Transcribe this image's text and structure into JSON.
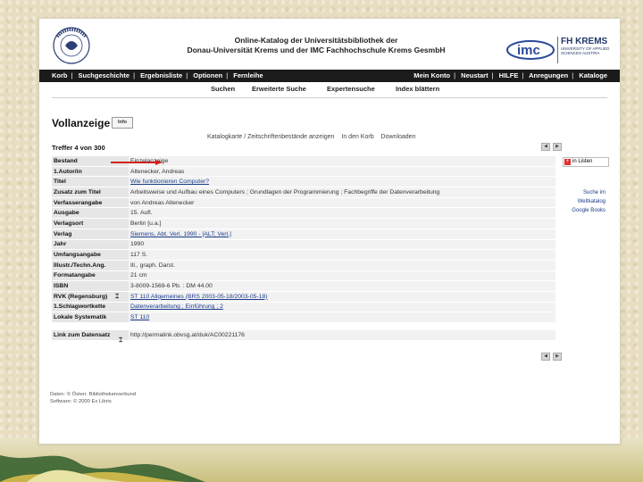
{
  "header": {
    "title_line1": "Online-Katalog der Universitätsbibliothek der",
    "title_line2": "Donau-Universität Krems und der IMC Fachhochschule Krems GesmbH",
    "fh_logo_big1": "FH KREMS",
    "fh_logo_small1": "UNIVERSITY OF APPLIED",
    "fh_logo_small2": "SCIENCES AUSTRIA",
    "imc_logo": "imc",
    "duk_logo": "DONAU-UNIVERSITÄT KREMS"
  },
  "nav": {
    "left": [
      "Korb",
      "Suchgeschichte",
      "Ergebnisliste",
      "Optionen",
      "Fernleihe"
    ],
    "right": [
      "Mein Konto",
      "Neustart",
      "HILFE",
      "Anregungen",
      "Kataloge"
    ]
  },
  "subnav": [
    "Suchen",
    "Erweiterte Suche",
    "Expertensuche",
    "Index blättern"
  ],
  "page": {
    "title": "Vollanzeige",
    "info_button": "Info",
    "links": [
      "Katalogkarte / Zeitschriftenbestände anzeigen",
      "In den Korb",
      "Downloaden"
    ],
    "hits": "Treffer 4 von 300"
  },
  "record": [
    {
      "key": "Bestand",
      "value": "Einzelanzeige"
    },
    {
      "key": "1.Autor/in",
      "value": "Altenecker, Andreas"
    },
    {
      "key": "Titel",
      "value": "Wie funktionieren Computer?",
      "link": true
    },
    {
      "key": "Zusatz zum Titel",
      "value": "Arbeitsweise und Aufbau eines Computers ; Grundlagen der Programmierung ; Fachbegriffe der Datenverarbeitung"
    },
    {
      "key": "Verfasserangabe",
      "value": "von Andreas Altenecker"
    },
    {
      "key": "Ausgabe",
      "value": "15. Aufl."
    },
    {
      "key": "Verlagsort",
      "value": "Berlin [u.a.]"
    },
    {
      "key": "Verlag",
      "value": "Siemens, Abt. Verl. 1990 - [ALT; Verl.]",
      "link": true
    },
    {
      "key": "Jahr",
      "value": "1990"
    },
    {
      "key": "Umfangsangabe",
      "value": "117 S."
    },
    {
      "key": "Illustr./Techn.Ang.",
      "value": "Ill., graph. Darst."
    },
    {
      "key": "Formatangabe",
      "value": "21 cm"
    },
    {
      "key": "ISBN",
      "value": "3-8009-1569-6 Pb. : DM 44.00"
    },
    {
      "key": "RVK (Regensburg)",
      "value": "ST 110 Allgemeines (BRS 2003-05-18/2003-05-18)",
      "link": true
    },
    {
      "key": "1.Schlagwortkette",
      "value": "Datenverarbeitung ; Einführung ; 2",
      "link": true
    },
    {
      "key": "Lokale Systematik",
      "value": "ST 110",
      "link": true
    },
    {
      "key": "",
      "value": ""
    },
    {
      "key": "Link zum Datensatz",
      "value": "http://permalink.obvsg.at/duk/AC00221176"
    }
  ],
  "side": {
    "box_label": "in Listen",
    "links": [
      "Suche im Weltkatalog",
      "Google Books"
    ]
  },
  "footer": {
    "line1": "Daten: © Österr. Bibliothekenverbund",
    "line2": "Software: © 2000 Ex Libris"
  },
  "colors": {
    "nav_bg": "#1b1b1b",
    "label_bg": "#e6e6e6",
    "value_bg": "#f2f2f2",
    "link": "#1a3c8a",
    "arrow": "#d32020",
    "page_bg": "#e8ddc0"
  }
}
